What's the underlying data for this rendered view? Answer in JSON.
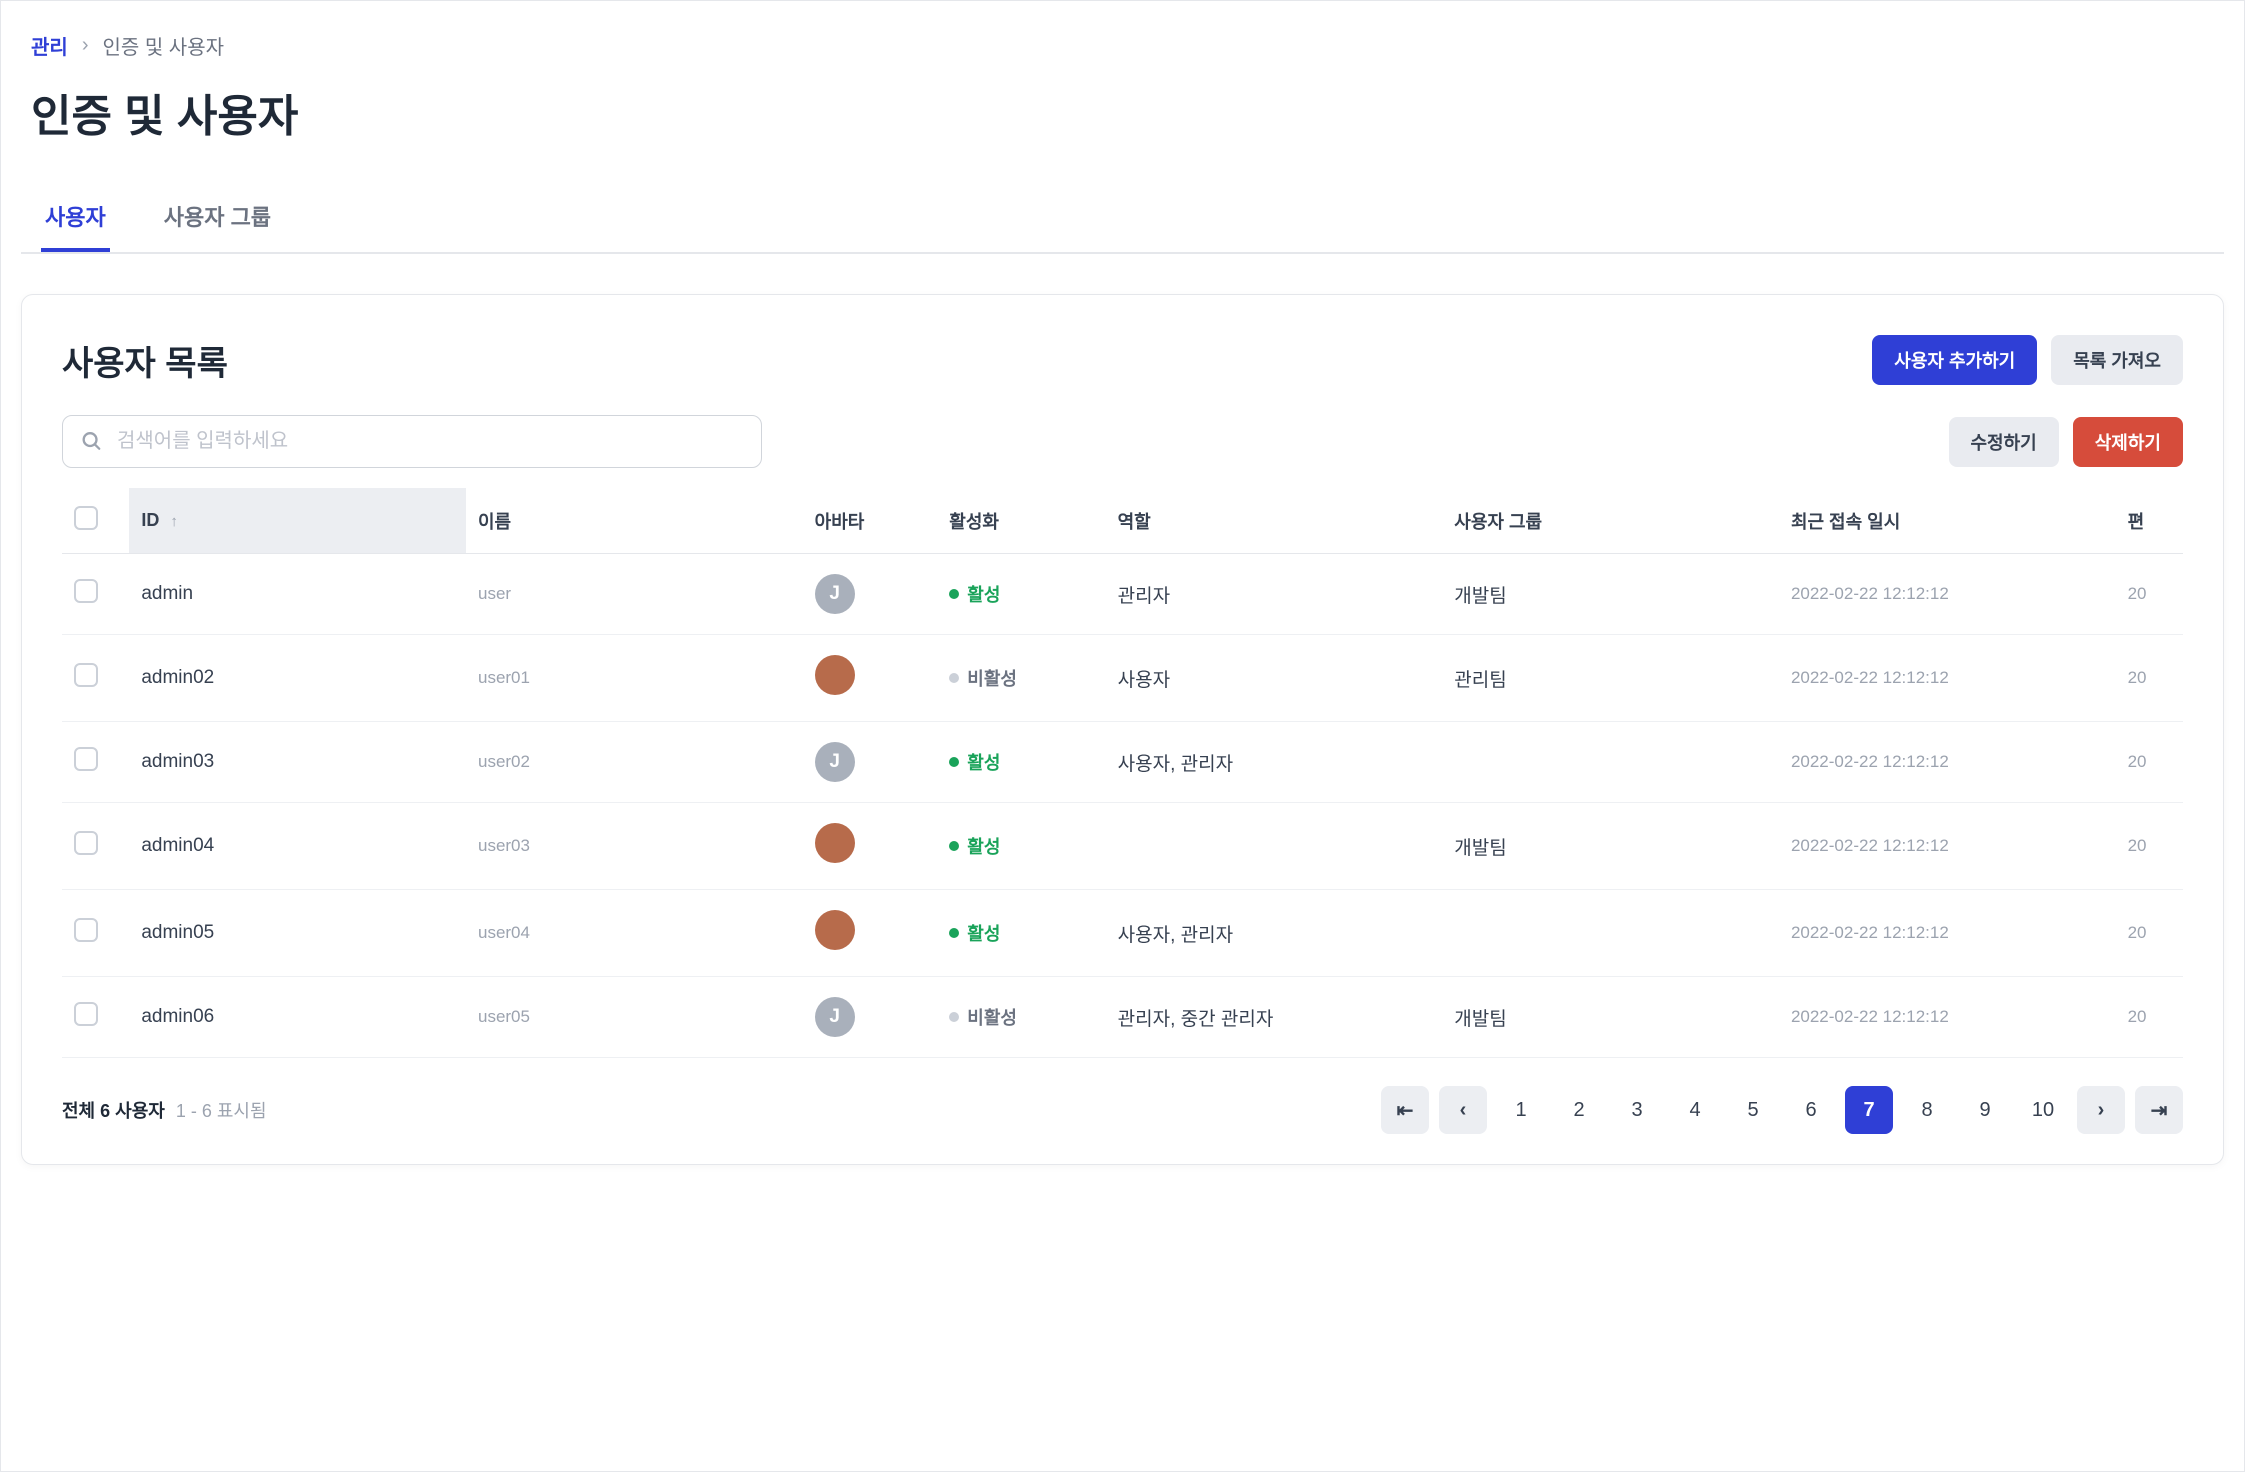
{
  "breadcrumb": {
    "root": "관리",
    "current": "인증 및 사용자"
  },
  "page_title": "인증 및 사용자",
  "tabs": [
    {
      "label": "사용자",
      "active": true
    },
    {
      "label": "사용자 그룹",
      "active": false
    }
  ],
  "list": {
    "title": "사용자 목록",
    "add_button": "사용자 추가하기",
    "import_button": "목록 가져오",
    "edit_button": "수정하기",
    "delete_button": "삭제하기",
    "search_placeholder": "검색어를 입력하세요"
  },
  "columns": {
    "id": "ID",
    "name": "이름",
    "avatar": "아바타",
    "active": "활성화",
    "role": "역할",
    "group": "사용자 그룹",
    "last_login": "최근 접속 일시",
    "extra": "편"
  },
  "status_labels": {
    "active": "활성",
    "inactive": "비활성"
  },
  "rows": [
    {
      "id": "admin",
      "name": "user",
      "avatar_type": "gray",
      "avatar_initial": "J",
      "active": true,
      "role": "관리자",
      "group": "개발팀",
      "last_login": "2022-02-22 12:12:12",
      "extra": "20"
    },
    {
      "id": "admin02",
      "name": "user01",
      "avatar_type": "img",
      "avatar_initial": "",
      "active": false,
      "role": "사용자",
      "group": "관리팀",
      "last_login": "2022-02-22 12:12:12",
      "extra": "20"
    },
    {
      "id": "admin03",
      "name": "user02",
      "avatar_type": "gray",
      "avatar_initial": "J",
      "active": true,
      "role": "사용자, 관리자",
      "group": "",
      "last_login": "2022-02-22 12:12:12",
      "extra": "20"
    },
    {
      "id": "admin04",
      "name": "user03",
      "avatar_type": "img",
      "avatar_initial": "",
      "active": true,
      "role": "",
      "group": "개발팀",
      "last_login": "2022-02-22 12:12:12",
      "extra": "20"
    },
    {
      "id": "admin05",
      "name": "user04",
      "avatar_type": "img",
      "avatar_initial": "",
      "active": true,
      "role": "사용자, 관리자",
      "group": "",
      "last_login": "2022-02-22 12:12:12",
      "extra": "20"
    },
    {
      "id": "admin06",
      "name": "user05",
      "avatar_type": "gray",
      "avatar_initial": "J",
      "active": false,
      "role": "관리자, 중간 관리자",
      "group": "개발팀",
      "last_login": "2022-02-22 12:12:12",
      "extra": "20"
    }
  ],
  "pagination": {
    "summary_bold": "전체 6 사용자",
    "summary_muted": "1 - 6 표시됨",
    "pages": [
      "1",
      "2",
      "3",
      "4",
      "5",
      "6",
      "7",
      "8",
      "9",
      "10"
    ],
    "current": "7"
  }
}
